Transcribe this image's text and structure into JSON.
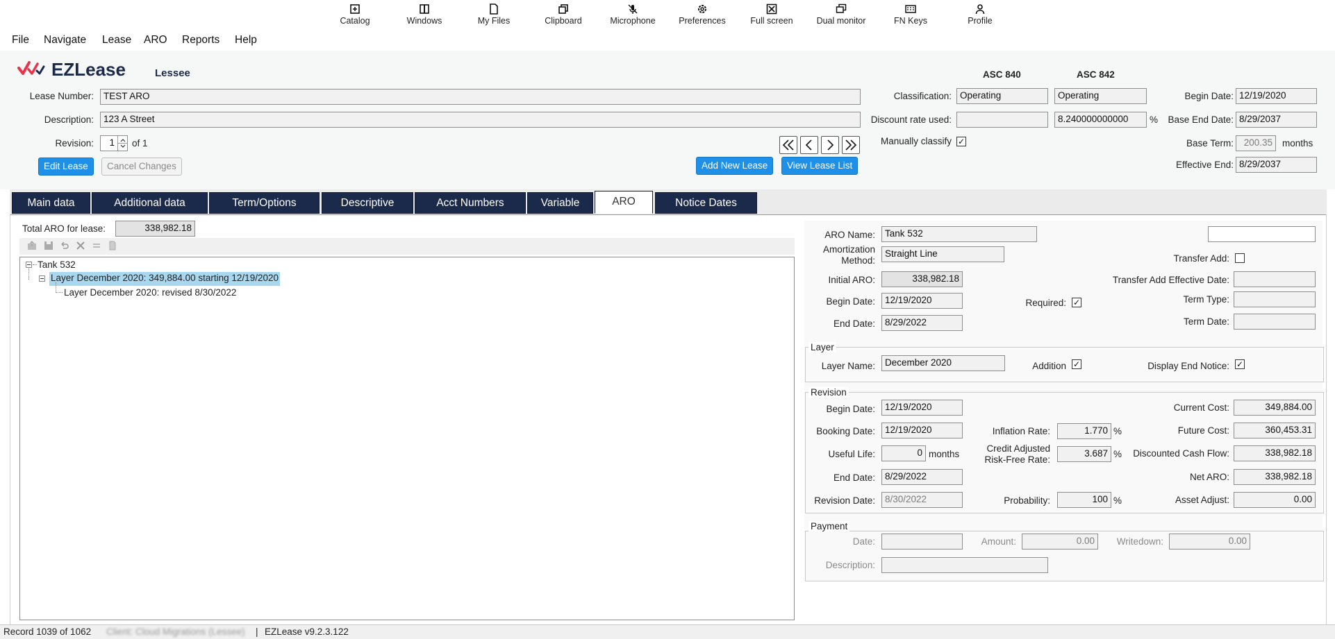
{
  "toolbar": {
    "catalog": "Catalog",
    "windows": "Windows",
    "my_files": "My Files",
    "clipboard": "Clipboard",
    "microphone": "Microphone",
    "preferences": "Preferences",
    "full_screen": "Full screen",
    "dual_monitor": "Dual monitor",
    "fn_keys": "FN Keys",
    "profile": "Profile"
  },
  "menu": {
    "file": "File",
    "navigate": "Navigate",
    "lease": "Lease",
    "aro": "ARO",
    "reports": "Reports",
    "help": "Help"
  },
  "brand": {
    "name": "EZLease",
    "mode": "Lessee"
  },
  "header": {
    "lease_number_label": "Lease Number:",
    "lease_number": "TEST ARO",
    "description_label": "Description:",
    "description": "123 A Street",
    "revision_label": "Revision:",
    "revision_value": "1",
    "revision_of": "of 1",
    "edit_lease": "Edit Lease",
    "cancel_changes": "Cancel Changes",
    "add_new_lease": "Add New Lease",
    "view_lease_list": "View Lease List",
    "asc840": "ASC 840",
    "asc842": "ASC 842",
    "classification_label": "Classification:",
    "classification_840": "Operating",
    "classification_842": "Operating",
    "discount_rate_label": "Discount rate used:",
    "discount_rate_840": "",
    "discount_rate_842": "8.240000000000",
    "percent": "%",
    "manually_classify_label": "Manually classify",
    "manually_classify_checked": "✓",
    "begin_date_label": "Begin Date:",
    "begin_date": "12/19/2020",
    "base_end_date_label": "Base End Date:",
    "base_end_date": "8/29/2037",
    "base_term_label": "Base Term:",
    "base_term": "200.35",
    "months": "months",
    "effective_end_label": "Effective End:",
    "effective_end": "8/29/2037"
  },
  "tabs": [
    {
      "label": "Main data"
    },
    {
      "label": "Additional data"
    },
    {
      "label": "Term/Options"
    },
    {
      "label": "Descriptive"
    },
    {
      "label": "Acct Numbers"
    },
    {
      "label": "Variable"
    },
    {
      "label": "ARO"
    },
    {
      "label": "Notice Dates"
    }
  ],
  "aro": {
    "total_label": "Total ARO for lease:",
    "total_value": "338,982.18",
    "tree": {
      "root": "Tank 532",
      "layer": "Layer December 2020: 349,884.00 starting 12/19/2020",
      "revision": "Layer December 2020: revised 8/30/2022"
    },
    "name_label": "ARO Name:",
    "name": "Tank 532",
    "extra_field": "",
    "amort_label_1": "Amortization",
    "amort_label_2": "Method:",
    "amort_method": "Straight Line",
    "transfer_add_label": "Transfer Add:",
    "initial_aro_label": "Initial ARO:",
    "initial_aro": "338,982.18",
    "transfer_add_eff_label": "Transfer Add Effective Date:",
    "transfer_add_eff": "",
    "begin_date_label": "Begin Date:",
    "begin_date": "12/19/2020",
    "required_label": "Required:",
    "required_checked": "✓",
    "term_type_label": "Term Type:",
    "term_type": "",
    "end_date_label": "End Date:",
    "end_date": "8/29/2022",
    "term_date_label": "Term Date:",
    "term_date": ""
  },
  "layer": {
    "title": "Layer",
    "name_label": "Layer Name:",
    "name": "December 2020",
    "addition_label": "Addition",
    "addition_checked": "✓",
    "display_end_label": "Display End Notice:",
    "display_end_checked": "✓"
  },
  "revision": {
    "title": "Revision",
    "begin_date_label": "Begin Date:",
    "begin_date": "12/19/2020",
    "current_cost_label": "Current Cost:",
    "current_cost": "349,884.00",
    "booking_date_label": "Booking Date:",
    "booking_date": "12/19/2020",
    "inflation_rate_label": "Inflation Rate:",
    "inflation_rate": "1.770",
    "future_cost_label": "Future Cost:",
    "future_cost": "360,453.31",
    "useful_life_label": "Useful Life:",
    "useful_life": "0",
    "months": "months",
    "credit_label_1": "Credit Adjusted",
    "credit_label_2": "Risk-Free Rate:",
    "credit_rate": "3.687",
    "dcf_label": "Discounted Cash Flow:",
    "dcf": "338,982.18",
    "end_date_label": "End Date:",
    "end_date": "8/29/2022",
    "net_aro_label": "Net ARO:",
    "net_aro": "338,982.18",
    "revision_date_label": "Revision Date:",
    "revision_date": "8/30/2022",
    "probability_label": "Probability:",
    "probability": "100",
    "asset_adjust_label": "Asset Adjust:",
    "asset_adjust": "0.00",
    "percent": "%"
  },
  "payment": {
    "title": "Payment",
    "date_label": "Date:",
    "date": "",
    "amount_label": "Amount:",
    "amount": "0.00",
    "writedown_label": "Writedown:",
    "writedown": "0.00",
    "description_label": "Description:",
    "description": ""
  },
  "status": {
    "record": "Record 1039 of 1062",
    "client": "Client: Cloud Migrations (Lessee)",
    "separator": "|",
    "version": "EZLease v9.2.3.122"
  }
}
